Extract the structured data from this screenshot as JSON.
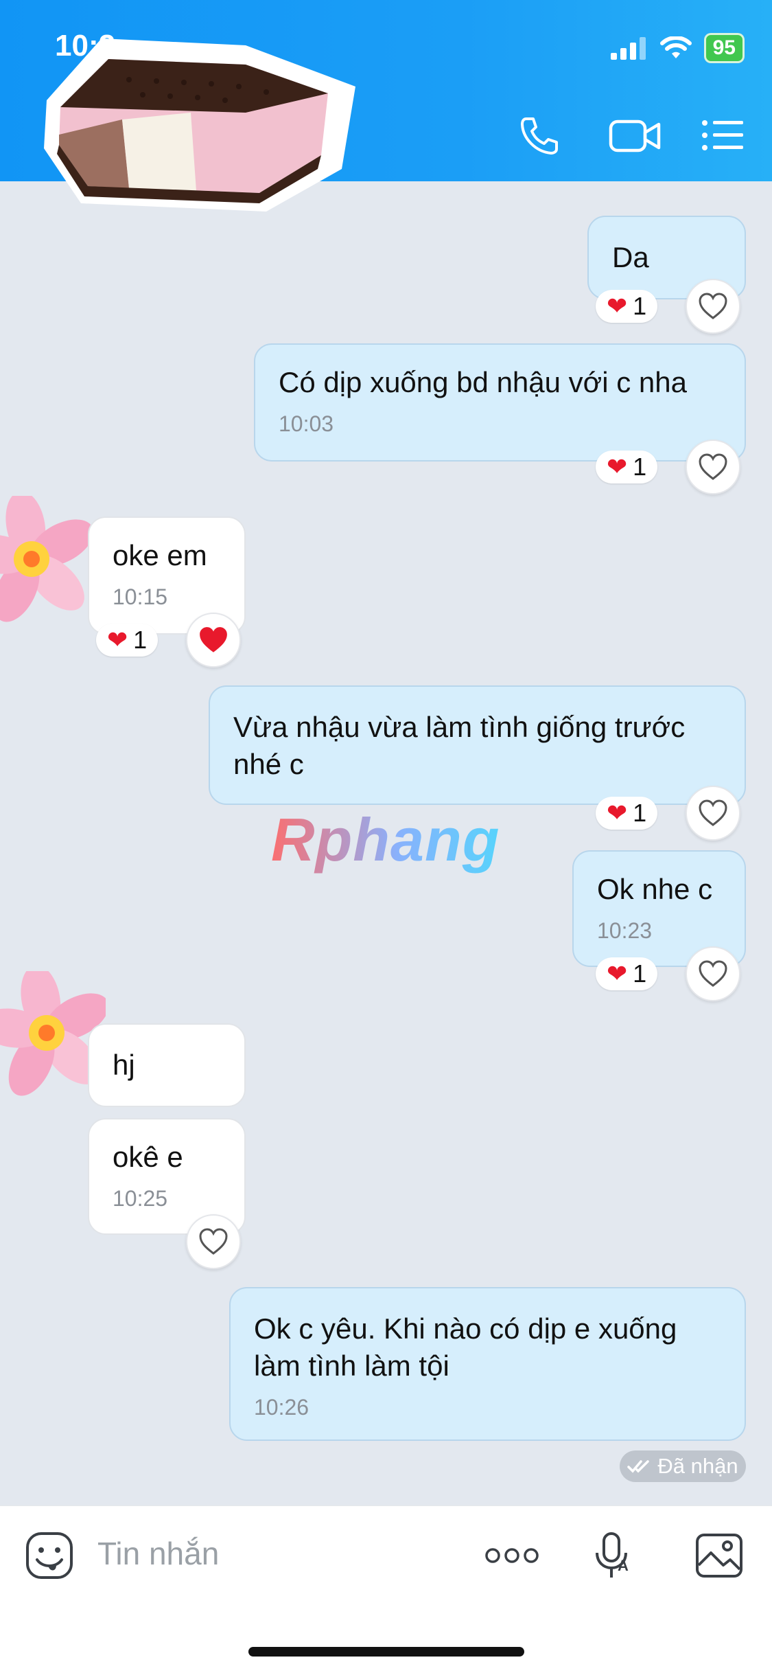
{
  "status_bar": {
    "time": "10:2",
    "battery": "95"
  },
  "header": {
    "call_icon": "phone-icon",
    "video_icon": "video-call-icon",
    "menu_icon": "list-menu-icon"
  },
  "messages": [
    {
      "direction": "out",
      "text": "Da",
      "time": "",
      "reaction": "❤",
      "reaction_count": "1"
    },
    {
      "direction": "out",
      "text": "Có dịp xuống bd nhậu với c nha",
      "time": "10:03",
      "reaction": "❤",
      "reaction_count": "1"
    },
    {
      "direction": "in",
      "text": "oke em",
      "time": "10:15",
      "reaction": "❤",
      "reaction_count": "1"
    },
    {
      "direction": "out",
      "text": "Vừa nhậu vừa làm tình giống trước nhé c",
      "time": "",
      "reaction": "❤",
      "reaction_count": "1"
    },
    {
      "direction": "out",
      "text": "Ok nhe c",
      "time": "10:23",
      "reaction": "❤",
      "reaction_count": "1"
    },
    {
      "direction": "in",
      "text": "hj",
      "time": ""
    },
    {
      "direction": "in",
      "text": "okê e",
      "time": "10:25"
    },
    {
      "direction": "out",
      "text": "Ok c yêu. Khi nào có dịp e xuống làm tình làm tội",
      "time": "10:26"
    }
  ],
  "received_label": "Đã nhận",
  "watermark": "Rphang",
  "input": {
    "placeholder": "Tin nhắn"
  },
  "colors": {
    "header": "#1b9ef6",
    "outgoing_bubble": "#d6eefc",
    "background": "#e3e8ef",
    "heart": "#e8192c"
  }
}
